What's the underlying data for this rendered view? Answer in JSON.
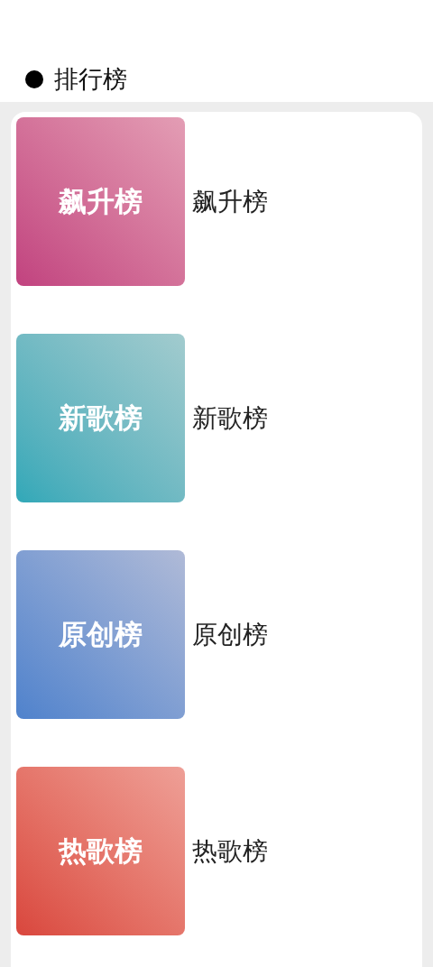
{
  "header": {
    "title": "排行榜"
  },
  "charts": [
    {
      "cover_title": "飙升榜",
      "name": "飙升榜",
      "color": "#c1427f"
    },
    {
      "cover_title": "新歌榜",
      "name": "新歌榜",
      "color": "#30a8b8"
    },
    {
      "cover_title": "原创榜",
      "name": "原创榜",
      "color": "#4f82cc"
    },
    {
      "cover_title": "热歌榜",
      "name": "热歌榜",
      "color": "#d9463d"
    }
  ]
}
